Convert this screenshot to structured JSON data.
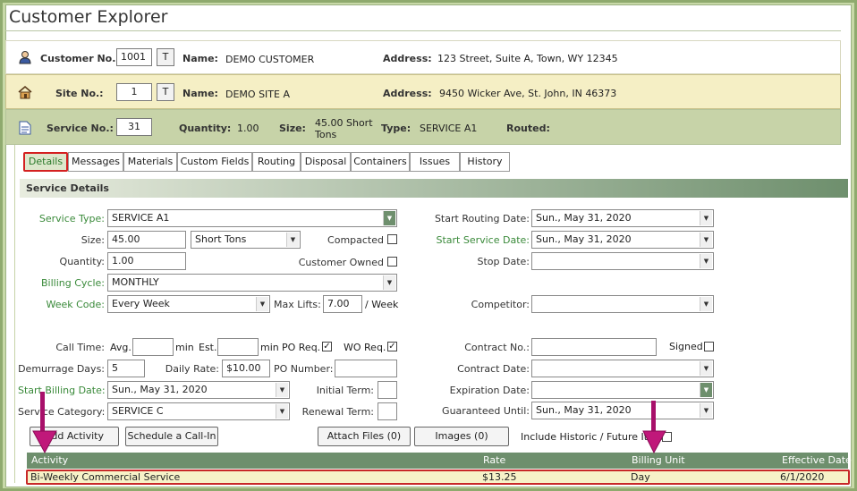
{
  "app": {
    "title": "Customer Explorer"
  },
  "customer": {
    "label": "Customer No.:",
    "number": "1001",
    "t_button": "T",
    "name_label": "Name:",
    "name": "DEMO CUSTOMER",
    "address_label": "Address:",
    "address": "123 Street, Suite A, Town, WY 12345"
  },
  "site": {
    "label": "Site No.:",
    "number": "1",
    "t_button": "T",
    "name_label": "Name:",
    "name": "DEMO SITE A",
    "address_label": "Address:",
    "address": "9450 Wicker Ave, St. John, IN 46373"
  },
  "service": {
    "label": "Service No.:",
    "number": "31",
    "quantity_label": "Quantity:",
    "quantity": "1.00",
    "size_label": "Size:",
    "size_line1": "45.00 Short",
    "size_line2": "Tons",
    "type_label": "Type:",
    "type": "SERVICE A1",
    "routed_label": "Routed:"
  },
  "tabs": [
    {
      "label": "Details"
    },
    {
      "label": "Messages"
    },
    {
      "label": "Materials"
    },
    {
      "label": "Custom Fields"
    },
    {
      "label": "Routing"
    },
    {
      "label": "Disposal"
    },
    {
      "label": "Containers"
    },
    {
      "label": "Issues"
    },
    {
      "label": "History"
    }
  ],
  "details": {
    "section_title": "Service Details",
    "service_type": {
      "label": "Service Type:",
      "value": "SERVICE A1"
    },
    "size": {
      "label": "Size:",
      "value": "45.00",
      "unit": "Short Tons"
    },
    "compacted": {
      "label": "Compacted",
      "checked": false
    },
    "quantity": {
      "label": "Quantity:",
      "value": "1.00"
    },
    "customer_owned": {
      "label": "Customer Owned",
      "checked": false
    },
    "billing_cycle": {
      "label": "Billing Cycle:",
      "value": "MONTHLY"
    },
    "week_code": {
      "label": "Week Code:",
      "value": "Every Week"
    },
    "max_lifts": {
      "label": "Max Lifts:",
      "value": "7.00",
      "unit": "/ Week"
    },
    "start_routing_date": {
      "label": "Start Routing Date:",
      "value": "Sun., May 31, 2020"
    },
    "start_service_date": {
      "label": "Start Service Date:",
      "value": "Sun., May 31, 2020"
    },
    "stop_date": {
      "label": "Stop Date:",
      "value": ""
    },
    "competitor": {
      "label": "Competitor:",
      "value": ""
    },
    "call_time": {
      "label": "Call Time:",
      "avg_label": "Avg.",
      "min_label": "min",
      "est_label": "Est.",
      "min2_label": "min"
    },
    "po_req": {
      "label": "PO Req.",
      "checked": true
    },
    "wo_req": {
      "label": "WO Req.",
      "checked": true
    },
    "contract_no": {
      "label": "Contract No.:",
      "value": ""
    },
    "signed": {
      "label": "Signed",
      "checked": false
    },
    "demurrage_days": {
      "label": "Demurrage Days:",
      "value": "5"
    },
    "daily_rate": {
      "label": "Daily Rate:",
      "value": "$10.00"
    },
    "po_number": {
      "label": "PO Number:",
      "value": ""
    },
    "contract_date": {
      "label": "Contract Date:",
      "value": ""
    },
    "start_billing_date": {
      "label": "Start Billing Date:",
      "value": "Sun., May 31, 2020"
    },
    "initial_term": {
      "label": "Initial Term:",
      "value": ""
    },
    "expiration_date": {
      "label": "Expiration Date:",
      "value": ""
    },
    "service_category": {
      "label": "Service Category:",
      "value": "SERVICE C"
    },
    "renewal_term": {
      "label": "Renewal Term:",
      "value": ""
    },
    "guaranteed_until": {
      "label": "Guaranteed Until:",
      "value": "Sun., May 31, 2020"
    },
    "include_historic": {
      "label": "Include Historic / Future Items",
      "checked": false
    }
  },
  "buttons": {
    "add_activity": "Add Activity",
    "schedule_call_in": "Schedule a Call-In",
    "attach_files": "Attach Files (0)",
    "images": "Images (0)"
  },
  "activity_table": {
    "columns": [
      "Activity",
      "Rate",
      "Billing Unit",
      "Effective Date"
    ],
    "rows": [
      {
        "activity": "Bi-Weekly Commercial Service",
        "rate": "$13.25",
        "billing_unit": "Day",
        "effective_date": "6/1/2020"
      }
    ]
  },
  "colors": {
    "accent_green": "#6e8f6d",
    "highlight_red": "#c82828",
    "site_band": "#f5efc5",
    "service_band": "#c7d3a8"
  }
}
